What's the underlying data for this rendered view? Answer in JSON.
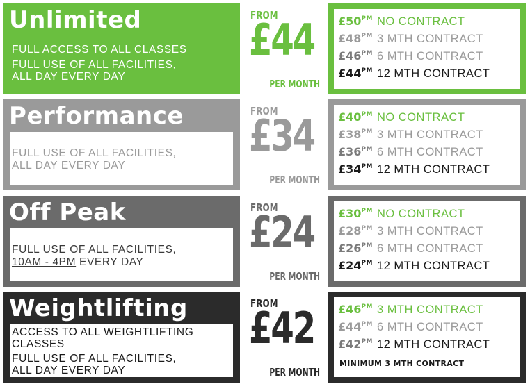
{
  "plans": [
    {
      "title": "Unlimited",
      "desc": [
        "FULL ACCESS TO ALL CLASSES",
        "FULL USE OF ALL FACILITIES,",
        "ALL DAY EVERY DAY"
      ],
      "from": "FROM",
      "price": "£44",
      "per": "PER MONTH",
      "rates": [
        {
          "price": "£50",
          "sup": "PM",
          "term": "NO CONTRACT"
        },
        {
          "price": "£48",
          "sup": "PM",
          "term": "3 MTH CONTRACT"
        },
        {
          "price": "£46",
          "sup": "PM",
          "term": "6 MTH CONTRACT"
        },
        {
          "price": "£44",
          "sup": "PM",
          "term": "12 MTH CONTRACT"
        }
      ]
    },
    {
      "title": "Performance",
      "desc": [
        "FULL USE OF ALL FACILITIES,",
        "ALL DAY EVERY DAY"
      ],
      "from": "FROM",
      "price": "£34",
      "per": "PER MONTH",
      "rates": [
        {
          "price": "£40",
          "sup": "PM",
          "term": "NO CONTRACT"
        },
        {
          "price": "£38",
          "sup": "PM",
          "term": "3 MTH CONTRACT"
        },
        {
          "price": "£36",
          "sup": "PM",
          "term": "6 MTH CONTRACT"
        },
        {
          "price": "£34",
          "sup": "PM",
          "term": "12 MTH CONTRACT"
        }
      ]
    },
    {
      "title": "Off Peak",
      "desc": [
        "FULL USE OF ALL FACILITIES,",
        "10AM - 4PM",
        " EVERY DAY"
      ],
      "from": "FROM",
      "price": "£24",
      "per": "PER MONTH",
      "rates": [
        {
          "price": "£30",
          "sup": "PM",
          "term": "NO CONTRACT"
        },
        {
          "price": "£28",
          "sup": "PM",
          "term": "3 MTH CONTRACT"
        },
        {
          "price": "£26",
          "sup": "PM",
          "term": "6 MTH CONTRACT"
        },
        {
          "price": "£24",
          "sup": "PM",
          "term": "12 MTH CONTRACT"
        }
      ]
    },
    {
      "title": "Weightlifting",
      "desc": [
        "ACCESS TO ALL WEIGHTLIFTING",
        "CLASSES",
        "FULL USE OF ALL FACILITIES,",
        "ALL DAY EVERY DAY"
      ],
      "from": "FROM",
      "price": "£42",
      "per": "PER MONTH",
      "rates": [
        {
          "price": "£46",
          "sup": "PM",
          "term": "3 MTH CONTRACT"
        },
        {
          "price": "£44",
          "sup": "PM",
          "term": "6 MTH CONTRACT"
        },
        {
          "price": "£42",
          "sup": "PM",
          "term": "12 MTH CONTRACT"
        }
      ],
      "note": "MINIMUM 3 MTH CONTRACT"
    }
  ],
  "colors": {
    "green": "#6abf3f",
    "light_grey": "#9a9a9a",
    "mid_grey": "#6b6b6b",
    "dark": "#2b2b2b"
  }
}
